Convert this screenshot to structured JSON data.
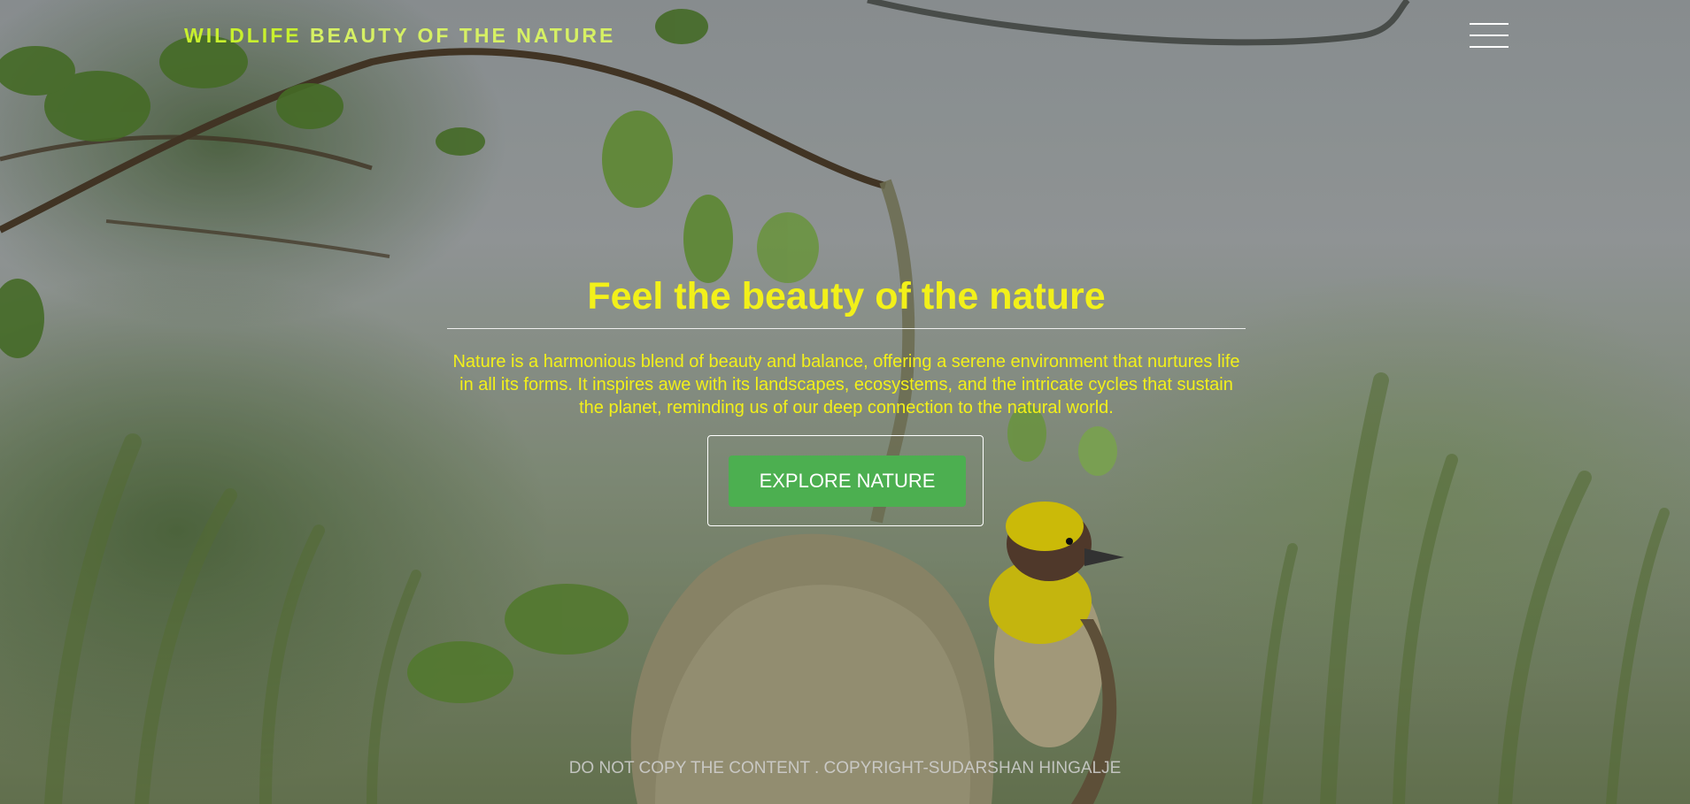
{
  "header": {
    "brand_bold": "WILDLIFE",
    "brand_light": "BEAUTY OF THE NATURE",
    "menu_icon": "hamburger-icon"
  },
  "hero": {
    "title": "Feel the beauty of the nature",
    "description": "Nature is a harmonious blend of beauty and balance, offering a serene environment that nurtures life in all its forms. It inspires awe with its landscapes, ecosystems, and the intricate cycles that sustain the planet, reminding us of our deep connection to the natural world.",
    "cta_label": "EXPLORE NATURE"
  },
  "footer": {
    "text": "DO NOT COPY THE CONTENT . COPYRIGHT-SUDARSHAN HINGALJE"
  },
  "colors": {
    "brand": "#c8f02e",
    "title": "#f2f01a",
    "button": "#4caf50",
    "button_text": "#ffffff"
  }
}
